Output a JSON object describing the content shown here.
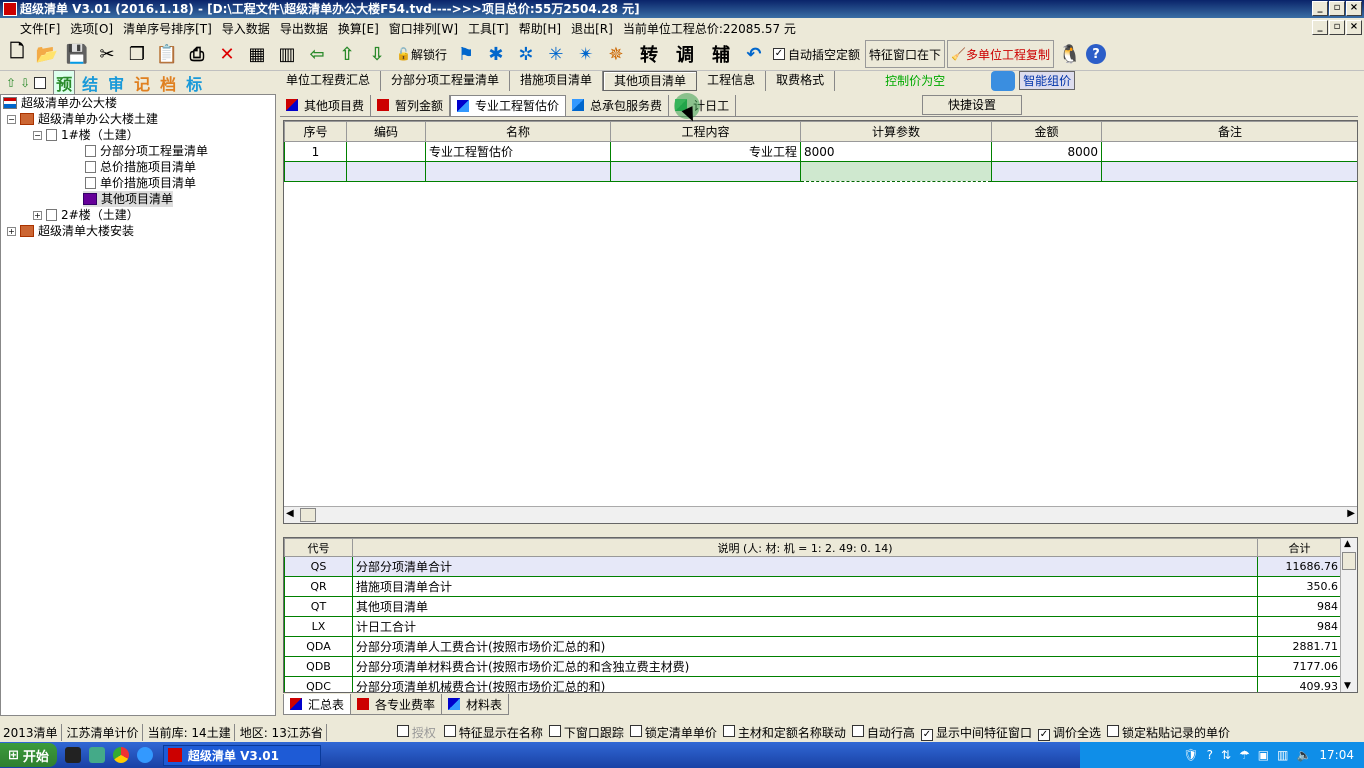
{
  "window": {
    "title": "超级清单 V3.01 (2016.1.18) - [D:\\工程文件\\超级清单办公大楼F54.tvd---->>>项目总价:55万2504.28 元]",
    "controls": [
      "_",
      "▫",
      "×"
    ]
  },
  "menu": [
    "文件[F]",
    "选项[O]",
    "清单序号排序[T]",
    "导入数据",
    "导出数据",
    "换算[E]",
    "窗口排列[W]",
    "工具[T]",
    "帮助[H]",
    "退出[R]",
    "当前单位工程总价:22085.57 元"
  ],
  "toolbar": {
    "unlock": "解锁行",
    "char_turn": "转",
    "char_adjust": "调",
    "char_aux": "辅",
    "auto_insert": "自动插空定额",
    "feature_window": "特征窗口在下",
    "multi_copy": "多单位工程复制",
    "ctrl_empty": "控制价为空",
    "smart_price": "智能组价"
  },
  "toolbar2": {
    "chars": [
      "预",
      "结",
      "审",
      "记",
      "档",
      "标"
    ]
  },
  "tabs_main": [
    "单位工程费汇总",
    "分部分项工程量清单",
    "措施项目清单",
    "其他项目清单",
    "工程信息",
    "取费格式"
  ],
  "tree": [
    {
      "label": "超级清单办公大楼",
      "level": 0
    },
    {
      "label": "超级清单办公大楼土建",
      "level": 1
    },
    {
      "label": "1#楼（土建）",
      "level": 2
    },
    {
      "label": "分部分项工程量清单",
      "level": 3
    },
    {
      "label": "总价措施项目清单",
      "level": 3
    },
    {
      "label": "单价措施项目清单",
      "level": 3
    },
    {
      "label": "其他项目清单",
      "level": 3
    },
    {
      "label": "2#楼（土建）",
      "level": 2
    },
    {
      "label": "超级清单大楼安装",
      "level": 1
    }
  ],
  "tabs_sub": [
    "其他项目费",
    "暂列金额",
    "专业工程暂估价",
    "总承包服务费",
    "计日工"
  ],
  "quick_settings": "快捷设置",
  "grid1": {
    "headers": [
      "序号",
      "编码",
      "名称",
      "工程内容",
      "计算参数",
      "金额",
      "备注"
    ],
    "rows": [
      [
        "1",
        "",
        "专业工程暂估价",
        "专业工程",
        "8000",
        "8000",
        ""
      ]
    ]
  },
  "grid2": {
    "headers": [
      "代号",
      "说明 (人: 材: 机 = 1: 2. 49: 0. 14)",
      "合计"
    ],
    "rows": [
      [
        "QS",
        "分部分项清单合计",
        "11686.76"
      ],
      [
        "QR",
        "措施项目清单合计",
        "350.6"
      ],
      [
        "QT",
        "其他项目清单",
        "984"
      ],
      [
        "LX",
        "计日工合计",
        "984"
      ],
      [
        "QDA",
        "分部分项清单人工费合计(按照市场价汇总的和)",
        "2881.71"
      ],
      [
        "QDB",
        "分部分项清单材料费合计(按照市场价汇总的和含独立费主材费)",
        "7177.06"
      ],
      [
        "QDC",
        "分部分项清单机械费合计(按照市场价汇总的和)",
        "409.93"
      ]
    ]
  },
  "tabs_bottom": [
    "汇总表",
    "各专业费率",
    "材料表"
  ],
  "status": {
    "cells": [
      "2013清单",
      "江苏清单计价",
      "当前库: 14土建",
      "地区: 13江苏省"
    ],
    "checks": [
      {
        "label": "授权",
        "on": false
      },
      {
        "label": "特征显示在名称",
        "on": false
      },
      {
        "label": "下窗口跟踪",
        "on": false
      },
      {
        "label": "锁定清单单价",
        "on": false
      },
      {
        "label": "主材和定额名称联动",
        "on": false
      },
      {
        "label": "自动行高",
        "on": false
      },
      {
        "label": "显示中间特征窗口",
        "on": true
      },
      {
        "label": "调价全选",
        "on": true
      },
      {
        "label": "锁定粘贴记录的单价",
        "on": false
      }
    ]
  },
  "taskbar": {
    "start": "开始",
    "app": "超级清单 V3.01",
    "clock": "17:04"
  }
}
